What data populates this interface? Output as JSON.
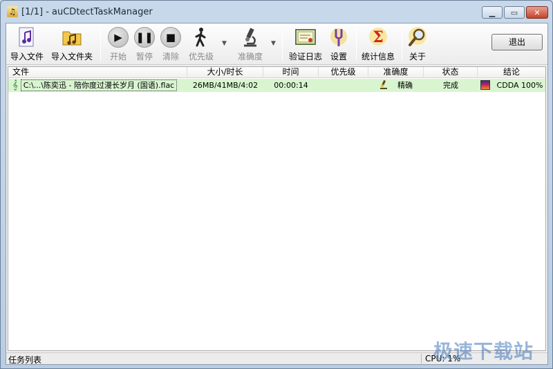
{
  "window": {
    "title": "[1/1] - auCDtectTaskManager"
  },
  "toolbar": {
    "import_file": "导入文件",
    "import_folder": "导入文件夹",
    "start": "开始",
    "pause": "暂停",
    "clear": "清除",
    "priority": "优先级",
    "accuracy": "准确度",
    "verify_log": "验证日志",
    "settings": "设置",
    "statistics": "统计信息",
    "about": "关于",
    "exit": "退出"
  },
  "table": {
    "columns": [
      "文件",
      "大小/时长",
      "时间",
      "优先级",
      "准确度",
      "状态",
      "结论"
    ],
    "rows": [
      {
        "file": "C:\\...\\陈奕迅 - 陪你度过漫长岁月 (国语).flac",
        "size_duration": "26MB/41MB/4:02",
        "time": "00:00:14",
        "priority": "",
        "accuracy": "精确",
        "status": "完成",
        "verdict": "CDDA 100%"
      }
    ]
  },
  "statusbar": {
    "left": "任务列表",
    "cpu": "CPU: 1%"
  },
  "watermark": "极速下载站",
  "colors": {
    "row_done": "#d8f5d0",
    "title_bar": "#c7d8ea"
  }
}
